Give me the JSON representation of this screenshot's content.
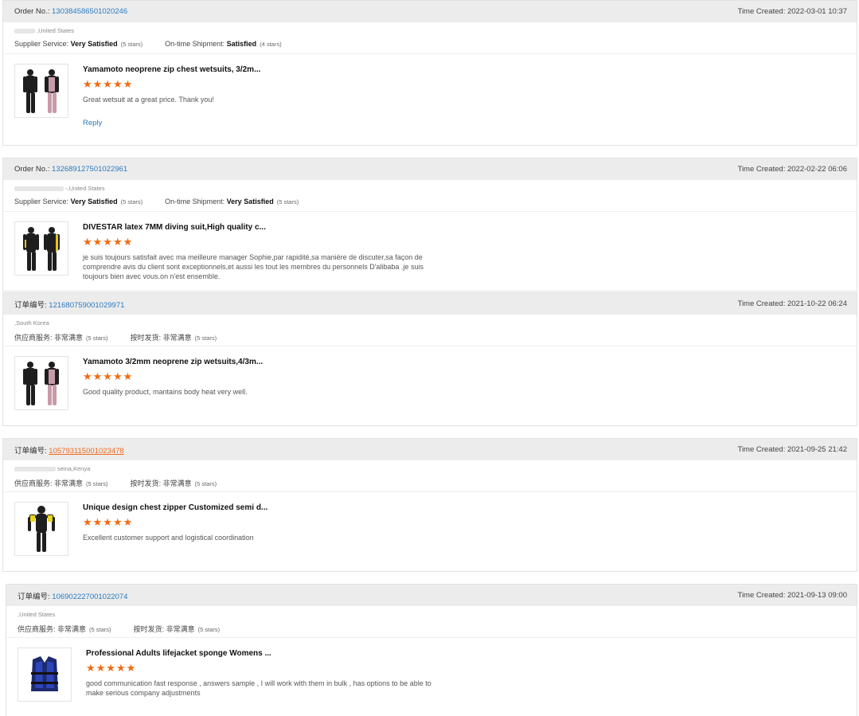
{
  "reviews": [
    {
      "order_label": "Order No.:",
      "order_no": "130384586501020246",
      "time_label": "Time Created:",
      "time": "2022-03-01 10:37",
      "location": ",United States",
      "supplier_label": "Supplier Service:",
      "supplier_value": "Very Satisfied",
      "supplier_stars": "(5 stars)",
      "shipment_label": "On-time Shipment:",
      "shipment_value": "Satisfied",
      "shipment_stars": "(4 stars)",
      "product_title": "Yamamoto neoprene zip chest wetsuits, 3/2m...",
      "rating": 5,
      "stars": "★★★★★",
      "comment": "Great wetsuit at a great price.  Thank you!",
      "reply": "Reply"
    },
    {
      "order_label": "Order No.:",
      "order_no": "132689127501022961",
      "time_label": "Time Created:",
      "time": "2022-02-22 06:06",
      "location": "-,United States",
      "supplier_label": "Supplier Service:",
      "supplier_value": "Very Satisfied",
      "supplier_stars": "(5 stars)",
      "shipment_label": "On-time Shipment:",
      "shipment_value": "Very Satisfied",
      "shipment_stars": "(5 stars)",
      "product_title": "DIVESTAR latex 7MM diving suit,High quality c...",
      "rating": 5,
      "stars": "★★★★★",
      "comment": "je suis toujours satisfait avec ma meilleure manager Sophie,par rapidité,sa manière de discuter,sa façon de comprendre avis du client sont exceptionnels,et aussi les tout les membres du personnels D'alibaba .je suis toujours bien avec vous.on n'est ensemble."
    },
    {
      "order_label": "订单编号:",
      "order_no": "121680759001029971",
      "time_label": "Time Created:",
      "time": "2021-10-22 06:24",
      "location": ",South Korea",
      "supplier_label": "供应商服务:",
      "supplier_value": "非常满意",
      "supplier_stars": "(5 stars)",
      "shipment_label": "按时发货:",
      "shipment_value": "非常满意",
      "shipment_stars": "(5 stars)",
      "product_title": "Yamamoto 3/2mm neoprene zip wetsuits,4/3m...",
      "rating": 5,
      "stars": "★★★★★",
      "comment": "Good quality product, mantains body heat very well."
    },
    {
      "order_label": "订单编号:",
      "order_no": "105793115001023478",
      "time_label": "Time Created:",
      "time": "2021-09-25 21:42",
      "location": "seina,Kenya",
      "supplier_label": "供应商服务:",
      "supplier_value": "非常满意",
      "supplier_stars": "(5 stars)",
      "shipment_label": "按时发货:",
      "shipment_value": "非常满意",
      "shipment_stars": "(5 stars)",
      "product_title": "Unique design chest zipper Customized semi d...",
      "rating": 5,
      "stars": "★★★★★",
      "comment": "Excellent customer support and logistical coordination"
    },
    {
      "order_label": "订单编号:",
      "order_no": "106902227001022074",
      "time_label": "Time Created:",
      "time": "2021-09-13 09:00",
      "location": ",United States",
      "supplier_label": "供应商服务:",
      "supplier_value": "非常满意",
      "supplier_stars": "(5 stars)",
      "shipment_label": "按时发货:",
      "shipment_value": "非常满意",
      "shipment_stars": "(5 stars)",
      "product_title": "Professional Adults lifejacket sponge Womens ...",
      "rating": 5,
      "stars": "★★★★★",
      "comment": "good communication fast response , answers sample , I will work with them in bulk , has options to be able to make serious company adjustments"
    }
  ]
}
